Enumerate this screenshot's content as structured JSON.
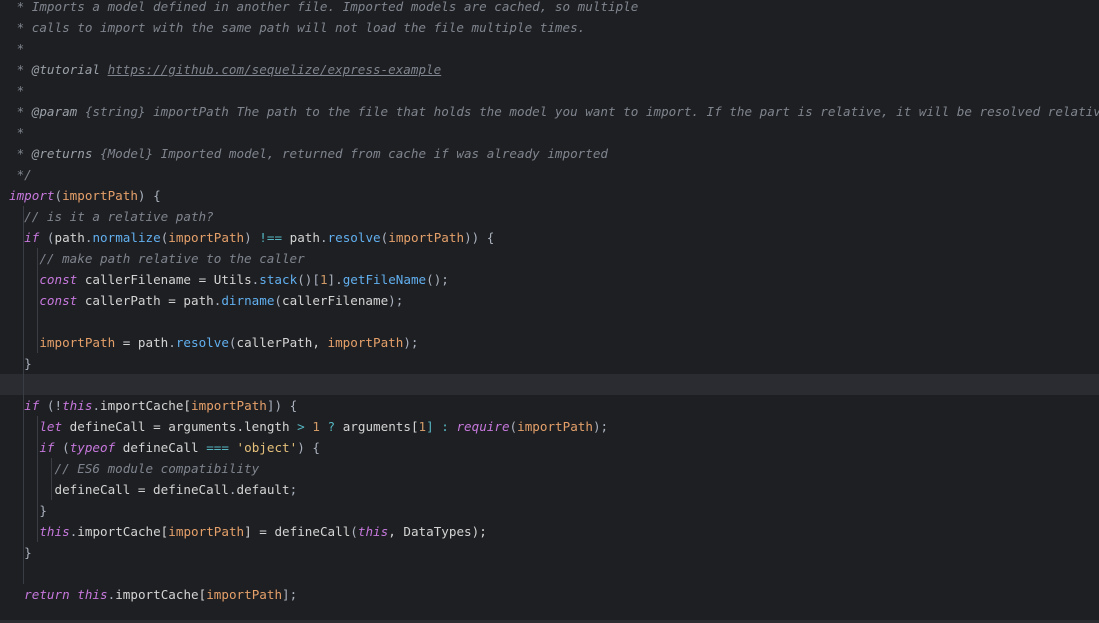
{
  "editor": {
    "colors": {
      "background": "#1e1f22",
      "active_line": "#2a2c31",
      "comment": "#7f848e",
      "keyword": "#c678dd",
      "function": "#61afef",
      "parameter": "#e5a06a",
      "string": "#e5c07b",
      "text": "#d4d4d4"
    },
    "lines": [
      [
        {
          "t": " * Imports a model defined in another file. Imported models are cached, so multiple",
          "c": "comment"
        }
      ],
      [
        {
          "t": " * calls to import with the same path will not load the file multiple times.",
          "c": "comment"
        }
      ],
      [
        {
          "t": " *",
          "c": "comment"
        }
      ],
      [
        {
          "t": " * ",
          "c": "comment"
        },
        {
          "t": "@tutorial",
          "c": "tag"
        },
        {
          "t": " ",
          "c": "comment"
        },
        {
          "t": "https://github.com/sequelize/express-example",
          "c": "link"
        }
      ],
      [
        {
          "t": " *",
          "c": "comment"
        }
      ],
      [
        {
          "t": " * ",
          "c": "comment"
        },
        {
          "t": "@param",
          "c": "tag"
        },
        {
          "t": " {string} importPath The path to the file that holds the model you want to import. If the part is relative, it will be resolved relatively to the c",
          "c": "comment"
        }
      ],
      [
        {
          "t": " *",
          "c": "comment"
        }
      ],
      [
        {
          "t": " * ",
          "c": "comment"
        },
        {
          "t": "@returns",
          "c": "tag"
        },
        {
          "t": " {Model} Imported model, returned from cache if was already imported",
          "c": "comment"
        }
      ],
      [
        {
          "t": " */",
          "c": "comment"
        }
      ],
      [
        {
          "t": "import",
          "c": "kw"
        },
        {
          "t": "(",
          "c": "punct"
        },
        {
          "t": "importPath",
          "c": "param"
        },
        {
          "t": ") {",
          "c": "punct"
        }
      ],
      [
        {
          "t": "  // is it a relative path?",
          "c": "comment"
        }
      ],
      [
        {
          "t": "  ",
          "c": "plain"
        },
        {
          "t": "if",
          "c": "kw"
        },
        {
          "t": " (",
          "c": "punct"
        },
        {
          "t": "path",
          "c": "plain"
        },
        {
          "t": ".",
          "c": "punct"
        },
        {
          "t": "normalize",
          "c": "fn"
        },
        {
          "t": "(",
          "c": "punct"
        },
        {
          "t": "importPath",
          "c": "param"
        },
        {
          "t": ") ",
          "c": "punct"
        },
        {
          "t": "!==",
          "c": "kw2"
        },
        {
          "t": " path",
          "c": "plain"
        },
        {
          "t": ".",
          "c": "punct"
        },
        {
          "t": "resolve",
          "c": "fn"
        },
        {
          "t": "(",
          "c": "punct"
        },
        {
          "t": "importPath",
          "c": "param"
        },
        {
          "t": ")) {",
          "c": "punct"
        }
      ],
      [
        {
          "t": "    // make path relative to the caller",
          "c": "comment"
        }
      ],
      [
        {
          "t": "    ",
          "c": "plain"
        },
        {
          "t": "const",
          "c": "kw"
        },
        {
          "t": " callerFilename = ",
          "c": "plain"
        },
        {
          "t": "Utils",
          "c": "plain"
        },
        {
          "t": ".",
          "c": "punct"
        },
        {
          "t": "stack",
          "c": "fn"
        },
        {
          "t": "()[",
          "c": "punct"
        },
        {
          "t": "1",
          "c": "num"
        },
        {
          "t": "].",
          "c": "punct"
        },
        {
          "t": "getFileName",
          "c": "fn"
        },
        {
          "t": "();",
          "c": "punct"
        }
      ],
      [
        {
          "t": "    ",
          "c": "plain"
        },
        {
          "t": "const",
          "c": "kw"
        },
        {
          "t": " callerPath = path",
          "c": "plain"
        },
        {
          "t": ".",
          "c": "punct"
        },
        {
          "t": "dirname",
          "c": "fn"
        },
        {
          "t": "(",
          "c": "punct"
        },
        {
          "t": "callerFilename",
          "c": "plain"
        },
        {
          "t": ");",
          "c": "punct"
        }
      ],
      [],
      [
        {
          "t": "    ",
          "c": "plain"
        },
        {
          "t": "importPath",
          "c": "param"
        },
        {
          "t": " = path",
          "c": "plain"
        },
        {
          "t": ".",
          "c": "punct"
        },
        {
          "t": "resolve",
          "c": "fn"
        },
        {
          "t": "(",
          "c": "punct"
        },
        {
          "t": "callerPath, ",
          "c": "plain"
        },
        {
          "t": "importPath",
          "c": "param"
        },
        {
          "t": ");",
          "c": "punct"
        }
      ],
      [
        {
          "t": "  }",
          "c": "punct"
        }
      ],
      [],
      [
        {
          "t": "  ",
          "c": "plain"
        },
        {
          "t": "if",
          "c": "kw"
        },
        {
          "t": " (!",
          "c": "punct"
        },
        {
          "t": "this",
          "c": "kw"
        },
        {
          "t": ".",
          "c": "punct"
        },
        {
          "t": "importCache[",
          "c": "plain"
        },
        {
          "t": "importPath",
          "c": "param"
        },
        {
          "t": "]) {",
          "c": "punct"
        }
      ],
      [
        {
          "t": "    ",
          "c": "plain"
        },
        {
          "t": "let",
          "c": "kw"
        },
        {
          "t": " defineCall = ",
          "c": "plain"
        },
        {
          "t": "arguments",
          "c": "plain"
        },
        {
          "t": ".length ",
          "c": "plain"
        },
        {
          "t": ">",
          "c": "kw2"
        },
        {
          "t": " ",
          "c": "plain"
        },
        {
          "t": "1",
          "c": "num"
        },
        {
          "t": " ? ",
          "c": "kw2"
        },
        {
          "t": "arguments[",
          "c": "plain"
        },
        {
          "t": "1",
          "c": "num"
        },
        {
          "t": "] : ",
          "c": "kw2"
        },
        {
          "t": "require",
          "c": "kw"
        },
        {
          "t": "(",
          "c": "punct"
        },
        {
          "t": "importPath",
          "c": "param"
        },
        {
          "t": ");",
          "c": "punct"
        }
      ],
      [
        {
          "t": "    ",
          "c": "plain"
        },
        {
          "t": "if",
          "c": "kw"
        },
        {
          "t": " (",
          "c": "punct"
        },
        {
          "t": "typeof",
          "c": "kw"
        },
        {
          "t": " defineCall ",
          "c": "plain"
        },
        {
          "t": "===",
          "c": "kw2"
        },
        {
          "t": " ",
          "c": "plain"
        },
        {
          "t": "'object'",
          "c": "str"
        },
        {
          "t": ") {",
          "c": "punct"
        }
      ],
      [
        {
          "t": "      // ES6 module compatibility",
          "c": "comment"
        }
      ],
      [
        {
          "t": "      defineCall = defineCall",
          "c": "plain"
        },
        {
          "t": ".",
          "c": "punct"
        },
        {
          "t": "default",
          "c": "plain"
        },
        {
          "t": ";",
          "c": "punct"
        }
      ],
      [
        {
          "t": "    }",
          "c": "punct"
        }
      ],
      [
        {
          "t": "    ",
          "c": "plain"
        },
        {
          "t": "this",
          "c": "kw"
        },
        {
          "t": ".",
          "c": "punct"
        },
        {
          "t": "importCache[",
          "c": "plain"
        },
        {
          "t": "importPath",
          "c": "param"
        },
        {
          "t": "] = ",
          "c": "plain"
        },
        {
          "t": "defineCall",
          "c": "plain"
        },
        {
          "t": "(",
          "c": "punct"
        },
        {
          "t": "this",
          "c": "kw"
        },
        {
          "t": ", DataTypes);",
          "c": "plain"
        }
      ],
      [
        {
          "t": "  }",
          "c": "punct"
        }
      ],
      [],
      [
        {
          "t": "  ",
          "c": "plain"
        },
        {
          "t": "return",
          "c": "kw"
        },
        {
          "t": " ",
          "c": "plain"
        },
        {
          "t": "this",
          "c": "kw"
        },
        {
          "t": ".",
          "c": "punct"
        },
        {
          "t": "importCache[",
          "c": "plain"
        },
        {
          "t": "importPath",
          "c": "param"
        },
        {
          "t": "];",
          "c": "punct"
        }
      ]
    ]
  }
}
